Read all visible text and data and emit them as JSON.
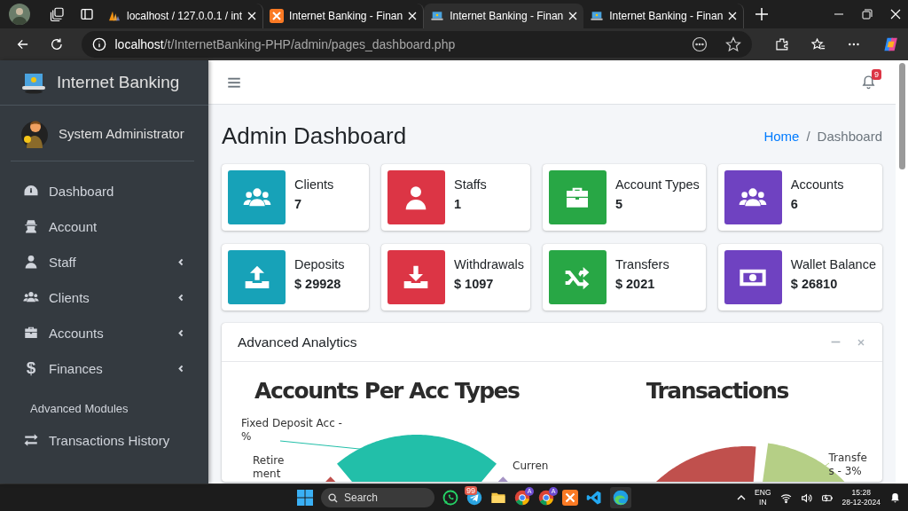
{
  "browser": {
    "tabs": [
      {
        "title": "localhost / 127.0.0.1 / int",
        "selected": false
      },
      {
        "title": "Internet Banking - Finan",
        "selected": false
      },
      {
        "title": "Internet Banking - Finan",
        "selected": true
      },
      {
        "title": "Internet Banking - Finan",
        "selected": false
      }
    ],
    "url_host": "localhost",
    "url_path": "/t/InternetBanking-PHP/admin/pages_dashboard.php"
  },
  "sidebar": {
    "brand": "Internet Banking",
    "user": "System Administrator",
    "nav": [
      {
        "label": "Dashboard",
        "submenu": false
      },
      {
        "label": "Account",
        "submenu": false
      },
      {
        "label": "Staff",
        "submenu": true
      },
      {
        "label": "Clients",
        "submenu": true
      },
      {
        "label": "Accounts",
        "submenu": true
      },
      {
        "label": "Finances",
        "glyph": "$",
        "submenu": true
      }
    ],
    "section_header": "Advanced Modules",
    "nav2": [
      {
        "label": "Transactions History",
        "submenu": false
      }
    ]
  },
  "navbar": {
    "notification_count": "9"
  },
  "page_title": "Admin Dashboard",
  "breadcrumb": [
    {
      "label": "Home",
      "kind": "link"
    },
    {
      "label": "/",
      "kind": "separator"
    },
    {
      "label": "Dashboard",
      "kind": "current"
    }
  ],
  "info_boxes": [
    {
      "label": "Clients",
      "value": "7",
      "color": "#17a2b8"
    },
    {
      "label": "Staffs",
      "value": "1",
      "color": "#dc3545"
    },
    {
      "label": "Account Types",
      "value": "5",
      "color": "#28a745"
    },
    {
      "label": "Accounts",
      "value": "6",
      "color": "#6f42c1"
    },
    {
      "label": "Deposits",
      "value": "$ 29928",
      "color": "#17a2b8"
    },
    {
      "label": "Withdrawals",
      "value": "$ 1097",
      "color": "#dc3545"
    },
    {
      "label": "Transfers",
      "value": "$ 2021",
      "color": "#28a745"
    },
    {
      "label": "Wallet Balance",
      "value": "$ 26810",
      "color": "#6f42c1"
    }
  ],
  "analytics": {
    "title": "Advanced Analytics",
    "charts": [
      {
        "title": "Accounts Per Acc Types",
        "labels": [
          "Fixed Deposit Acc -\n%",
          "Retire\nment",
          "Curren"
        ]
      },
      {
        "title": "Transactions",
        "labels": [
          "Transfe\ns - 3%"
        ]
      }
    ]
  },
  "taskbar": {
    "search_placeholder": "Search",
    "badge": "99",
    "profile_letters": [
      "A",
      "A"
    ],
    "language": "ENG",
    "region": "IN",
    "time": "15:28",
    "date": "28-12-2024"
  }
}
